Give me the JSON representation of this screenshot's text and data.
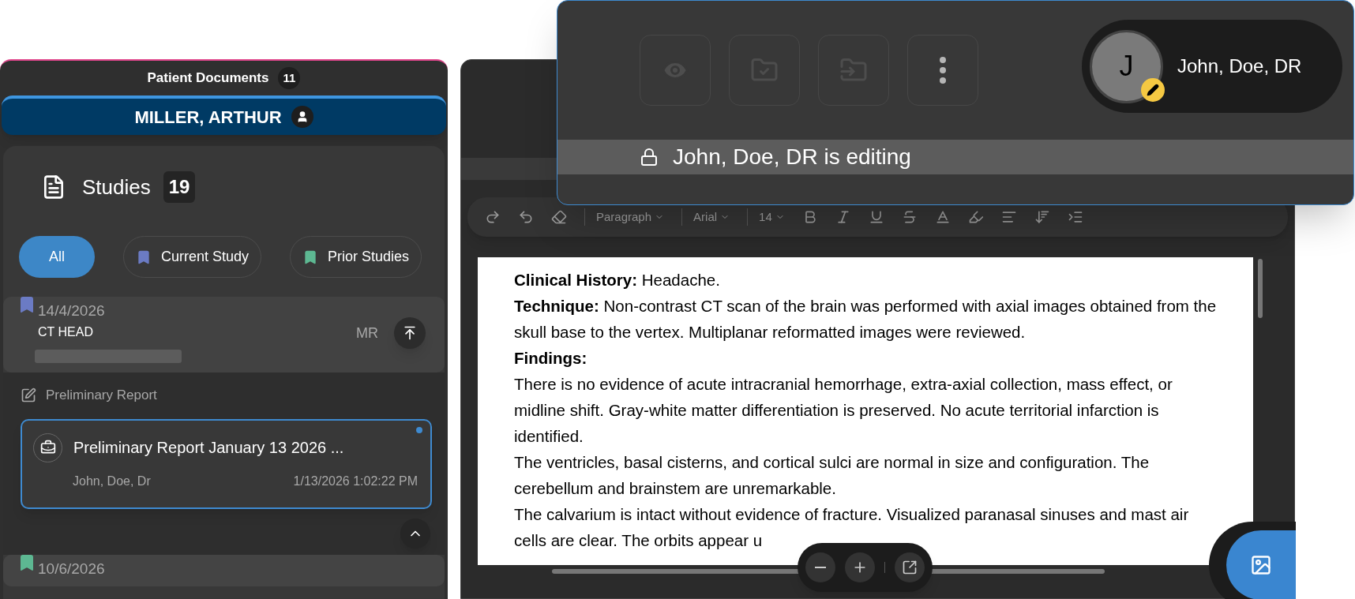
{
  "patient_documents": {
    "title": "Patient Documents",
    "count": "11"
  },
  "patient": {
    "name": "MILLER, ARTHUR"
  },
  "studies": {
    "title": "Studies",
    "count": "19",
    "filters": [
      {
        "label": "All",
        "selected": true
      },
      {
        "label": "Current Study",
        "selected": false,
        "color": "#6b7bc4"
      },
      {
        "label": "Prior Studies",
        "selected": false,
        "color": "#5db892"
      }
    ],
    "items": [
      {
        "date": "14/4/2026",
        "description": "CT HEAD",
        "modality": "MR",
        "color": "#6b7bc4",
        "expanded": true,
        "section": "Preliminary Report",
        "reports": [
          {
            "title": "Preliminary Report January 13 2026 ...",
            "author": "John, Doe, Dr",
            "timestamp": "1/13/2026 1:02:22 PM",
            "unread": true,
            "selected": true
          }
        ]
      },
      {
        "date": "10/6/2026",
        "color": "#5db892",
        "expanded": false
      }
    ]
  },
  "toolbar": {
    "dropdowns": [
      "Paragraph",
      "Arial",
      "14"
    ]
  },
  "document": {
    "paragraphs": [
      {
        "kind": "labeled",
        "text": "**Clinical History:** Headache."
      },
      {
        "kind": "labeled",
        "text": "**Technique:** Non-contrast CT scan of the brain was performed with axial images obtained from the skull base to the vertex. Multiplanar reformatted images were reviewed."
      },
      {
        "kind": "heading",
        "text": "Findings:"
      },
      {
        "kind": "body",
        "text": "There is no evidence of acute intracranial hemorrhage, extra-axial collection, mass effect, or midline shift. Gray-white matter differentiation is preserved. No acute territorial infarction is identified."
      },
      {
        "kind": "body",
        "text": "The ventricles, basal cisterns, and cortical sulci are normal in size and configuration. The cerebellum and brainstem are unremarkable."
      },
      {
        "kind": "body",
        "text": "The calvarium is intact without evidence of fracture. Visualized paranasal sinuses and mast air cells are clear. The orbits appear u"
      }
    ]
  },
  "overlay": {
    "user": {
      "initial": "J",
      "name": "John, Doe, DR"
    },
    "lock_message": "John, Doe, DR is editing"
  }
}
